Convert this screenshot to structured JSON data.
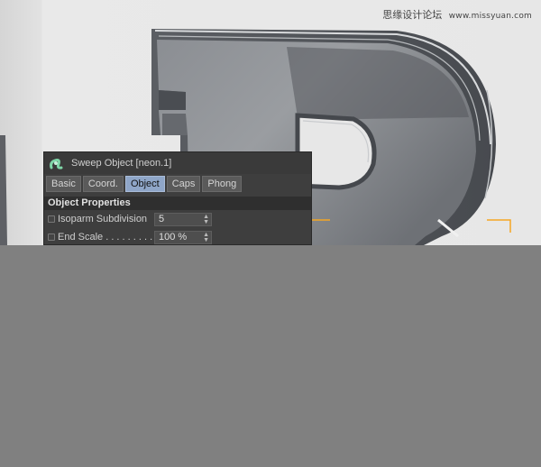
{
  "watermark": {
    "text": "思缘设计论坛",
    "url": "www.missyuan.com"
  },
  "panel": {
    "title": "Sweep Object [neon.1]",
    "icon": "sweep-object-icon",
    "tabs": [
      {
        "label": "Basic",
        "active": false
      },
      {
        "label": "Coord.",
        "active": false
      },
      {
        "label": "Object",
        "active": true
      },
      {
        "label": "Caps",
        "active": false
      },
      {
        "label": "Phong",
        "active": false
      }
    ],
    "section_title": "Object Properties",
    "properties": [
      {
        "label": "Isoparm Subdivision",
        "value": "5"
      },
      {
        "label": "End Scale . . . . . . . . .",
        "value": "100 %"
      }
    ]
  },
  "colors": {
    "panel_bg": "#3e3e3e",
    "tab_active": "#8fa6c8",
    "selection_orange": "#f5a623",
    "lower_area": "#808080"
  }
}
